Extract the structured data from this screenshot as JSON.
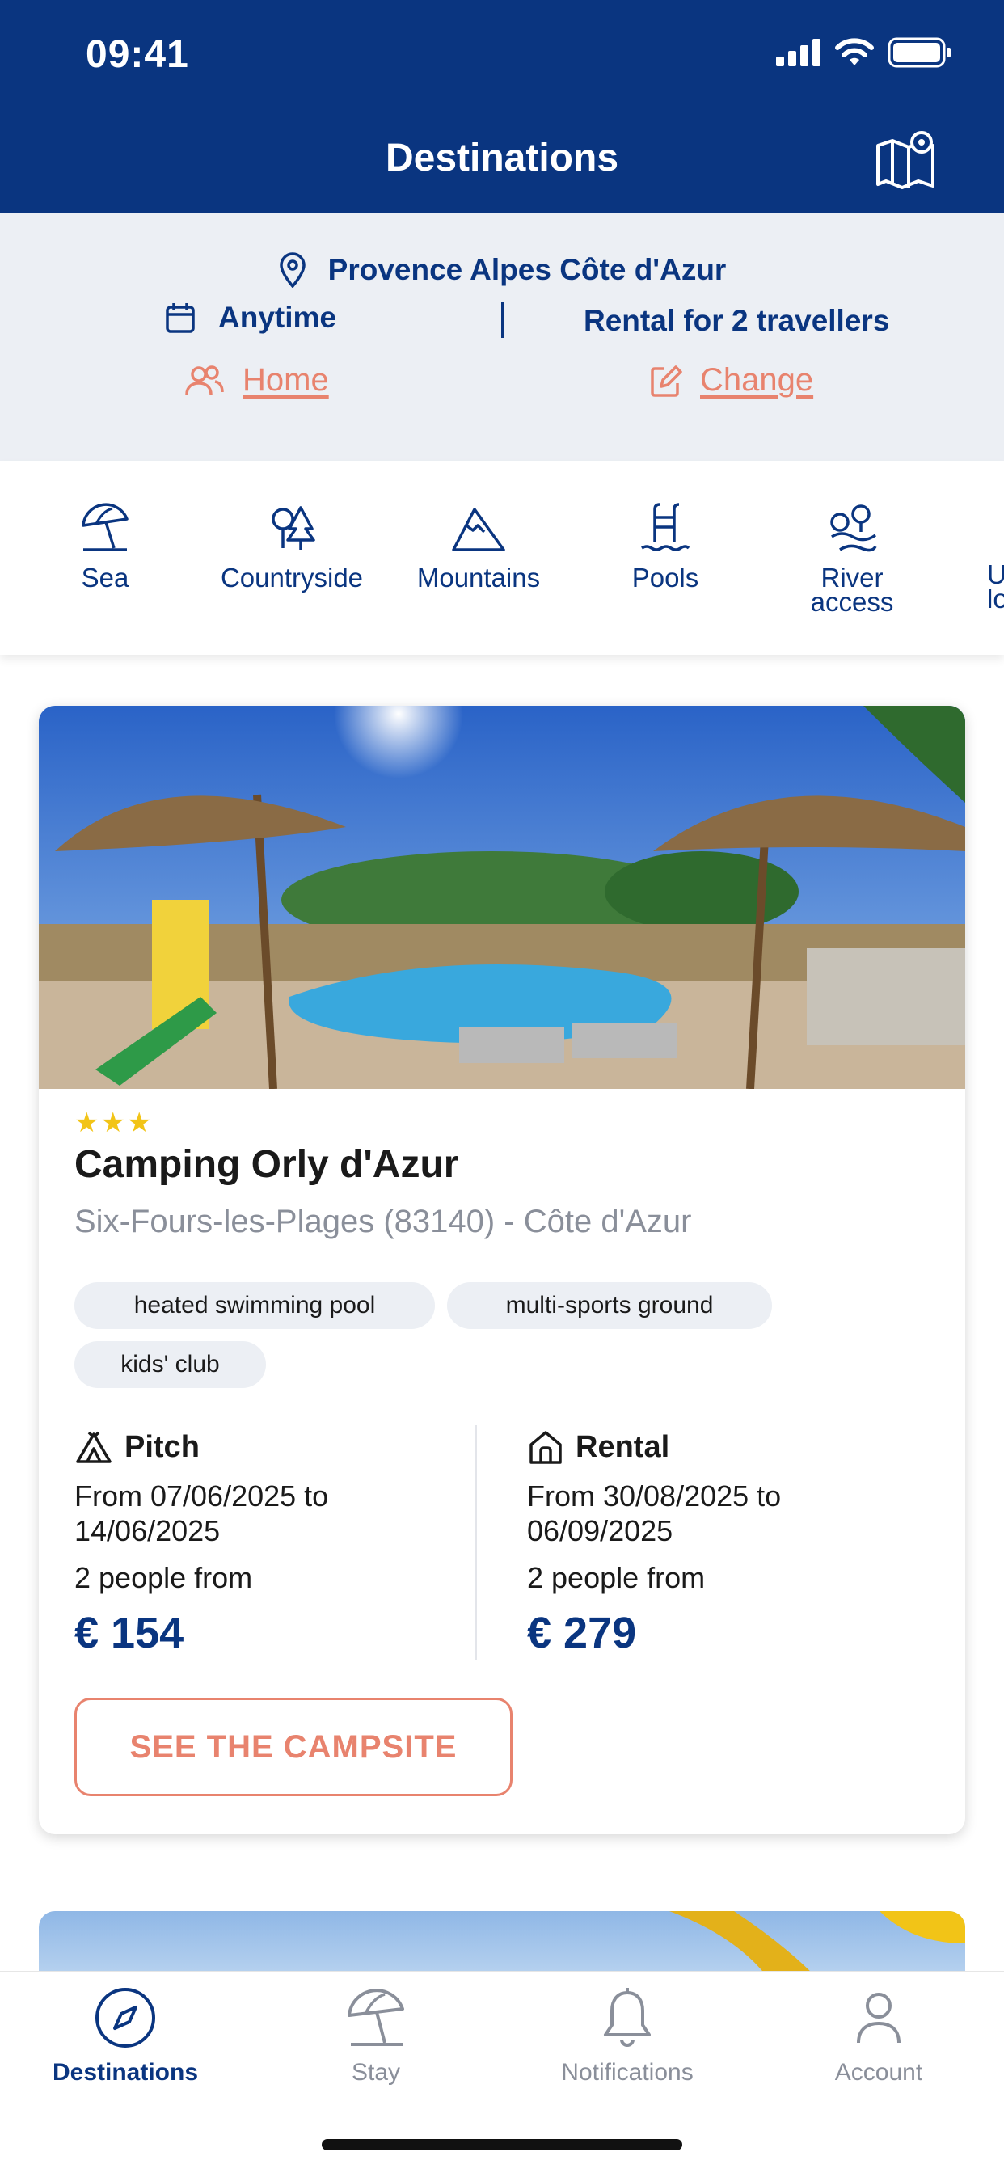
{
  "status_bar": {
    "time": "09:41"
  },
  "header": {
    "title": "Destinations",
    "map_icon": "map-icon"
  },
  "search": {
    "location": "Provence Alpes Côte d'Azur",
    "dates": "Anytime",
    "travellers": "Rental for 2 travellers",
    "home_label": "Home",
    "change_label": "Change"
  },
  "categories": [
    {
      "label": "Sea",
      "icon": "beach-umbrella-icon"
    },
    {
      "label": "Countryside",
      "icon": "trees-icon"
    },
    {
      "label": "Mountains",
      "icon": "mountain-icon"
    },
    {
      "label": "Pools",
      "icon": "pool-ladder-icon"
    },
    {
      "label": "River",
      "label2": "access",
      "icon": "river-access-icon"
    },
    {
      "label": "U",
      "label2": "lo",
      "icon": ""
    }
  ],
  "campsite": {
    "stars": "★★★",
    "name": "Camping Orly d'Azur",
    "location": "Six-Fours-les-Plages (83140) - Côte d'Azur",
    "tags": [
      "heated swimming pool",
      "multi-sports ground",
      "kids' club"
    ],
    "pitch": {
      "title": "Pitch",
      "dates": "From 07/06/2025 to 14/06/2025",
      "people": "2 people from",
      "price": "€ 154"
    },
    "rental": {
      "title": "Rental",
      "dates": "From 30/08/2025 to 06/09/2025",
      "people": "2 people from",
      "price": "€ 279"
    },
    "cta": "SEE THE CAMPSITE"
  },
  "tabbar": [
    {
      "label": "Destinations",
      "icon": "compass-icon",
      "active": true
    },
    {
      "label": "Stay",
      "icon": "beach-umbrella-icon",
      "active": false
    },
    {
      "label": "Notifications",
      "icon": "bell-icon",
      "active": false
    },
    {
      "label": "Account",
      "icon": "user-icon",
      "active": false
    }
  ],
  "colors": {
    "brand": "#0a3580",
    "accent": "#e8836e",
    "star": "#f2c417",
    "background_panel": "#eceff4"
  }
}
